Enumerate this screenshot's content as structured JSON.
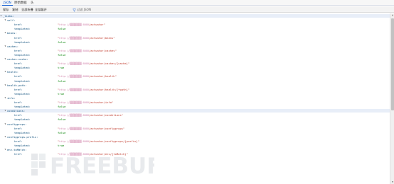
{
  "tabs": [
    {
      "label": "JSON",
      "active": true
    },
    {
      "label": "原始数据",
      "active": false
    },
    {
      "label": "头",
      "active": false
    }
  ],
  "toolbar": {
    "save": "保存",
    "copy": "复制",
    "collapse_all": "全部折叠",
    "expand_all": "全部展开",
    "filter_placeholder": "过滤 JSON"
  },
  "json_rows": [
    {
      "key": "_links:",
      "indent": 0,
      "expandable": true,
      "selected": true
    },
    {
      "key": "self:",
      "indent": 1,
      "expandable": true
    },
    {
      "key": "href:",
      "indent": 2,
      "value_pre": "\"",
      "value_masked": "http://▒▒▒▒▒▒▒▒:8080",
      "value_post": "/actuator\"",
      "type": "string"
    },
    {
      "key": "templated:",
      "indent": 2,
      "value": "false",
      "type": "bool"
    },
    {
      "key": "beans:",
      "indent": 1,
      "expandable": true
    },
    {
      "key": "href:",
      "indent": 2,
      "value_pre": "\"",
      "value_masked": "http://▒▒▒▒▒▒▒▒:8080",
      "value_post": "/actuator/beans\"",
      "type": "string"
    },
    {
      "key": "templated:",
      "indent": 2,
      "value": "false",
      "type": "bool"
    },
    {
      "key": "caches:",
      "indent": 1,
      "expandable": true
    },
    {
      "key": "href:",
      "indent": 2,
      "value_pre": "\"",
      "value_masked": "http://▒▒▒▒▒▒▒▒:8080",
      "value_post": "/actuator/caches\"",
      "type": "string"
    },
    {
      "key": "templated:",
      "indent": 2,
      "value": "false",
      "type": "bool"
    },
    {
      "key": "caches-cache:",
      "indent": 1,
      "expandable": true
    },
    {
      "key": "href:",
      "indent": 2,
      "value_pre": "\"",
      "value_masked": "http://▒▒▒▒▒▒▒▒:8080",
      "value_post": "/actuator/caches/{cache}\"",
      "type": "string"
    },
    {
      "key": "templated:",
      "indent": 2,
      "value": "true",
      "type": "bool"
    },
    {
      "key": "health:",
      "indent": 1,
      "expandable": true
    },
    {
      "key": "href:",
      "indent": 2,
      "value_pre": "\"",
      "value_masked": "http://▒▒▒▒▒▒▒▒:8080",
      "value_post": "/actuator/health\"",
      "type": "string"
    },
    {
      "key": "templated:",
      "indent": 2,
      "value": "false",
      "type": "bool"
    },
    {
      "key": "health-path:",
      "indent": 1,
      "expandable": true
    },
    {
      "key": "href:",
      "indent": 2,
      "value_pre": "\"",
      "value_masked": "http://▒▒▒▒▒▒▒▒:8080",
      "value_post": "/actuator/health/{*path}\"",
      "type": "string"
    },
    {
      "key": "templated:",
      "indent": 2,
      "value": "true",
      "type": "bool"
    },
    {
      "key": "info:",
      "indent": 1,
      "expandable": true
    },
    {
      "key": "href:",
      "indent": 2,
      "value_pre": "\"",
      "value_masked": "http://▒▒▒▒▒▒▒▒:8080",
      "value_post": "/actuator/info\"",
      "type": "string"
    },
    {
      "key": "templated:",
      "indent": 2,
      "value": "false",
      "type": "bool"
    },
    {
      "key": "conditions:",
      "indent": 1,
      "expandable": true,
      "selected": true
    },
    {
      "key": "href:",
      "indent": 2,
      "value_pre": "\"",
      "value_masked": "http://▒▒▒▒▒▒▒▒:8080",
      "value_post": "/actuator/conditions\"",
      "type": "string"
    },
    {
      "key": "templated:",
      "indent": 2,
      "value": "false",
      "type": "bool"
    },
    {
      "key": "configprops:",
      "indent": 1,
      "expandable": true
    },
    {
      "key": "href:",
      "indent": 2,
      "value_pre": "\"",
      "value_masked": "http://▒▒▒▒▒▒▒▒:8080",
      "value_post": "/actuator/configprops\"",
      "type": "string"
    },
    {
      "key": "templated:",
      "indent": 2,
      "value": "false",
      "type": "bool"
    },
    {
      "key": "configprops-prefix:",
      "indent": 1,
      "expandable": true
    },
    {
      "key": "href:",
      "indent": 2,
      "value_pre": "\"",
      "value_masked": "http://▒▒▒▒▒▒▒▒:8080",
      "value_post": "/actuator/configprops/{prefix}\"",
      "type": "string"
    },
    {
      "key": "templated:",
      "indent": 2,
      "value": "true",
      "type": "bool"
    },
    {
      "key": "env-toMatch:",
      "indent": 1,
      "expandable": true
    },
    {
      "key": "href:",
      "indent": 2,
      "value_pre": "\"",
      "value_masked": "http://▒▒▒▒▒▒▒▒:8080",
      "value_post": "/actuator/env/{toMatch}\"",
      "type": "string"
    }
  ],
  "watermark": {
    "text": "FREEBUF"
  },
  "icons": {
    "expand": "triangle-down-icon",
    "filter": "funnel-icon",
    "scroll_up": "scroll-up-arrow-icon",
    "scroll_down": "scroll-down-arrow-icon"
  },
  "colors": {
    "accent": "#0b57d0",
    "json_key": "#0b4d7a",
    "json_string": "#c0392b",
    "json_masked": "#d58fb3",
    "json_bool": "#008000",
    "selection": "#e8eef8"
  }
}
